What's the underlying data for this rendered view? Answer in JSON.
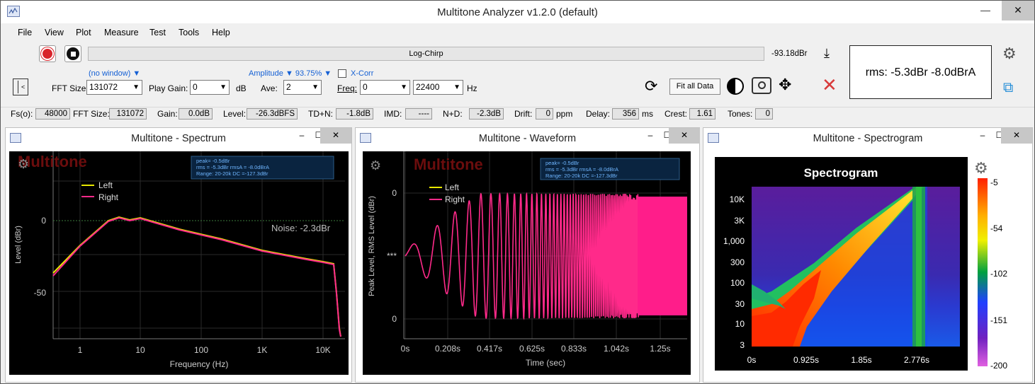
{
  "app": {
    "title": "Multitone Analyzer v1.2.0 (default)"
  },
  "menu": [
    "File",
    "View",
    "Plot",
    "Measure",
    "Test",
    "Tools",
    "Help"
  ],
  "toolbar": {
    "chirp_label": "Log-Chirp",
    "level_readout": "-93.18dBr",
    "fft_size_label": "FFT Size:",
    "fft_size_value": "131072",
    "window_label": "(no window)",
    "play_gain_label": "Play Gain:",
    "play_gain_value": "0",
    "db_unit": "dB",
    "amplitude_label": "Amplitude",
    "amplitude_value": "93.75%",
    "ave_label": "Ave:",
    "ave_value": "2",
    "xcorr_label": "X-Corr",
    "freq_label": "Freq:",
    "freq_from": "0",
    "freq_to": "22400",
    "hz_unit": "Hz",
    "fit_all_label": "Fit all Data",
    "rms_display": "rms: -5.3dBr  -8.0dBrA"
  },
  "status": {
    "fs_label": "Fs(o):",
    "fs": "48000",
    "fft_label": "FFT Size:",
    "fft": "131072",
    "gain_label": "Gain:",
    "gain": "0.0dB",
    "level_label": "Level:",
    "level": "-26.3dBFS",
    "tdn_label": "TD+N:",
    "tdn": "-1.8dB",
    "imd_label": "IMD:",
    "imd": "----",
    "nd_label": "N+D:",
    "nd": "-2.3dB",
    "drift_label": "Drift:",
    "drift": "0",
    "drift_unit": "ppm",
    "delay_label": "Delay:",
    "delay": "356",
    "delay_unit": "ms",
    "crest_label": "Crest:",
    "crest": "1.61",
    "tones_label": "Tones:",
    "tones": "0"
  },
  "panels": {
    "spectrum_title": "Multitone - Spectrum",
    "waveform_title": "Multitone - Waveform",
    "spectrogram_title": "Multitone - Spectrogram"
  },
  "overlay": {
    "watermark": "Multitone",
    "line1": "peak=  -0.5dBr",
    "line2": "rms =  -5.3dBr      rmsA =  -8.0dBrA",
    "line3": "Range: 20-20k      DC   =-127.3dBr",
    "legend_left": "Left",
    "legend_right": "Right"
  },
  "spectrum": {
    "noise_label": "Noise: -2.3dBr",
    "ylabel": "Level (dBr)",
    "xlabel": "Frequency (Hz)",
    "yticks": [
      "0",
      "-50"
    ],
    "xticks": [
      "1",
      "10",
      "100",
      "1K",
      "10K"
    ]
  },
  "waveform": {
    "ylabel": "Peak Level, RMS Level (dBr)",
    "xlabel": "Time (sec)",
    "yticks": [
      "0",
      "***",
      "0"
    ],
    "xticks": [
      "0s",
      "0.208s",
      "0.417s",
      "0.625s",
      "0.833s",
      "1.042s",
      "1.25s"
    ]
  },
  "spectrogram": {
    "title": "Spectrogram",
    "yticks": [
      "10K",
      "3K",
      "1,000",
      "300",
      "100",
      "30",
      "10",
      "3"
    ],
    "xticks": [
      "0s",
      "0.925s",
      "1.85s",
      "2.776s"
    ],
    "cbar_ticks": [
      "-5",
      "-54",
      "-102",
      "-151",
      "-200"
    ]
  },
  "colors": {
    "left": "#e8e800",
    "right": "#ff2a8a",
    "accent": "#1560d4"
  }
}
